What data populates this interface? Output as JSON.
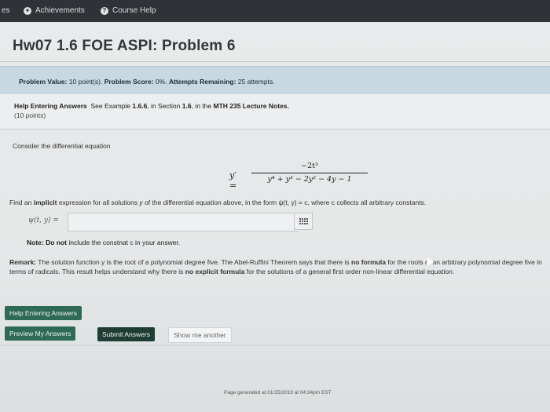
{
  "topbar": {
    "left_fragment": "es",
    "achievements": "Achievements",
    "course_help": "Course Help"
  },
  "title": "Hw07 1.6 FOE ASPI: Problem 6",
  "problem_info": {
    "value_label": "Problem Value:",
    "value": "10 point(s).",
    "score_label": "Problem Score:",
    "score": "0%.",
    "attempts_label": "Attempts Remaining:",
    "attempts": "25 attempts."
  },
  "help": {
    "heading": "Help Entering Answers",
    "see_example": "See Example",
    "example_ref": "1.6.6",
    "in_section": ", in Section",
    "section_ref": "1.6",
    "in_the": ", in the",
    "notes_title": "MTH 235 Lecture Notes.",
    "points": "(10 points)"
  },
  "consider": "Consider the differential equation",
  "equation": {
    "lhs": "y′ =",
    "numerator": "−2t³",
    "denominator": "y⁴ + y³ − 2y² − 4y − 1"
  },
  "find": {
    "prefix": "Find an",
    "implicit": "implicit",
    "middle": "expression for all solutions",
    "y": "y",
    "rest": "of the differential equation above, in the form ψ(t, y) = c, where c collects all arbitrary constants."
  },
  "answer": {
    "label": "ψ(t, y) =",
    "value": "",
    "placeholder": ""
  },
  "note": {
    "label": "Note:",
    "do_not": "Do not",
    "text": "include the constnat c in your answer."
  },
  "remark": {
    "label": "Remark:",
    "text1": "The solution function y is the root of a polynomial degree five. The Abel-Ruffini Theorem says that there is",
    "no_formula": "no formula",
    "text2": "for the roots of an arbitrary polynomial degree five in terms of radicals. This result helps understand why there is",
    "no_explicit": "no explicit formula",
    "text3": "for the solutions of a general first order non-linear differential equation."
  },
  "buttons": {
    "help_entering": "Help Entering Answers",
    "preview": "Preview My Answers",
    "submit": "Submit Answers",
    "show_another": "Show me another"
  },
  "footer": {
    "generated": "Page generated at 01/25/2019 at 04:34pm EST"
  }
}
